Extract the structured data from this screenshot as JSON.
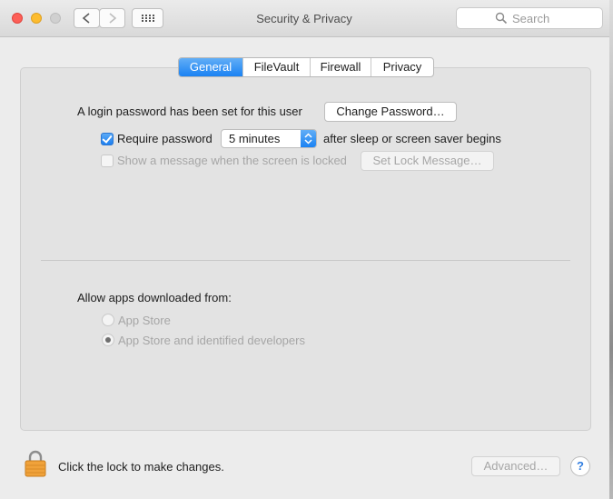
{
  "window": {
    "title": "Security & Privacy"
  },
  "search": {
    "placeholder": "Search"
  },
  "tabs": [
    {
      "label": "General",
      "active": true
    },
    {
      "label": "FileVault",
      "active": false
    },
    {
      "label": "Firewall",
      "active": false
    },
    {
      "label": "Privacy",
      "active": false
    }
  ],
  "general": {
    "login_password_label": "A login password has been set for this user",
    "change_password_button": "Change Password…",
    "require_password_label": "Require password",
    "require_password_checked": true,
    "require_password_delay": "5 minutes",
    "after_sleep_label": "after sleep or screen saver begins",
    "show_message_label": "Show a message when the screen is locked",
    "show_message_checked": false,
    "set_lock_message_button": "Set Lock Message…"
  },
  "allow_apps": {
    "heading": "Allow apps downloaded from:",
    "options": [
      {
        "label": "App Store",
        "selected": false
      },
      {
        "label": "App Store and identified developers",
        "selected": true
      }
    ]
  },
  "footer": {
    "lock_label": "Click the lock to make changes.",
    "advanced_button": "Advanced…",
    "help_button": "?"
  },
  "icons": {
    "lock": "lock-icon",
    "back": "chevron-left-icon",
    "forward": "chevron-right-icon",
    "grid": "show-all-grid-icon",
    "search": "search-icon"
  },
  "colors": {
    "accent_blue": "#1a82f3",
    "lock_orange": "#f0a23a",
    "close": "#fd5f57",
    "minimize": "#fdbc2e",
    "zoom_inactive": "#d0d0d0"
  }
}
